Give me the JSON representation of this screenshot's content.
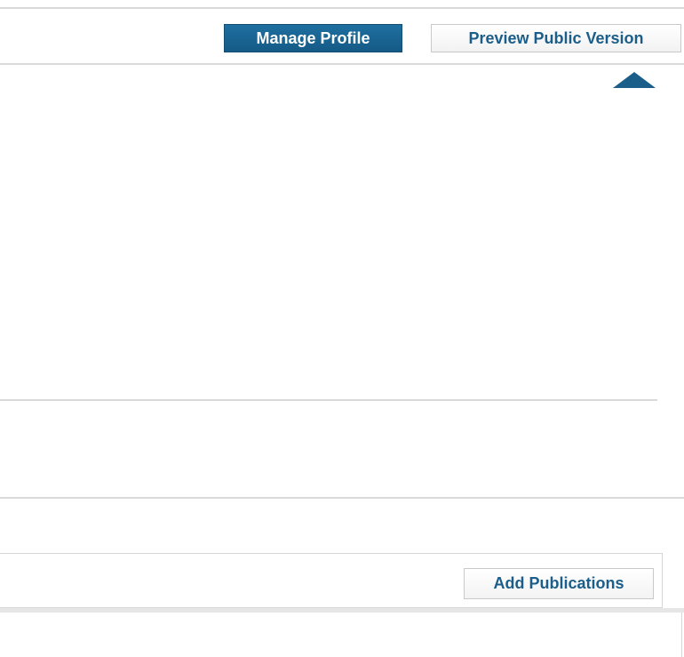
{
  "header": {
    "manage_profile_label": "Manage Profile",
    "preview_public_label": "Preview Public Version"
  },
  "publications": {
    "add_label": "Add Publications"
  },
  "colors": {
    "accent": "#1b5e8a",
    "primary_button": "#1e6fa0",
    "divider": "#d9d9d9"
  },
  "icons": {
    "active_tab_indicator": "caret-up-icon"
  }
}
